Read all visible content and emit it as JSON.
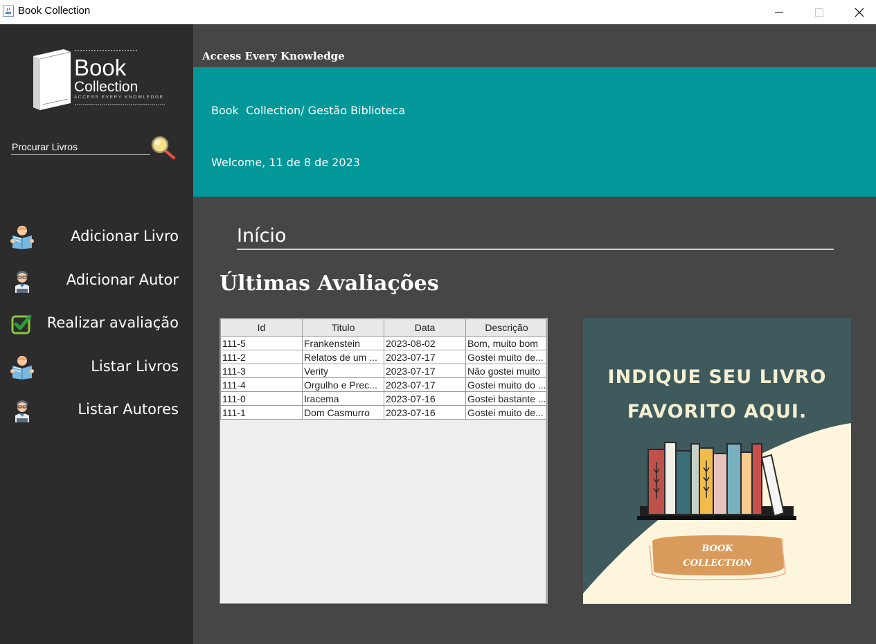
{
  "window": {
    "title": "Book Collection"
  },
  "sidebar": {
    "logo": {
      "word1": "Book",
      "word2": "Collection",
      "tagline": "ACCESS EVERY KNOWLEDGE"
    },
    "search": {
      "placeholder": "Procurar Livros"
    },
    "items": [
      {
        "label": "Adicionar Livro",
        "icon": "reader-icon"
      },
      {
        "label": "Adicionar Autor",
        "icon": "author-icon"
      },
      {
        "label": "Realizar avaliação",
        "icon": "checkbox-icon"
      },
      {
        "label": "Listar Livros",
        "icon": "reader-icon"
      },
      {
        "label": "Listar Autores",
        "icon": "author-icon"
      }
    ]
  },
  "header": {
    "tagline": "Access Every Knowledge",
    "path": "Book  Collection/ Gestão Biblioteca",
    "welcome": "Welcome, 11 de 8 de 2023"
  },
  "main": {
    "section_title": "Início",
    "reviews_heading": "Últimas Avaliações",
    "table": {
      "columns": [
        "Id",
        "Titulo",
        "Data",
        "Descrição"
      ],
      "rows": [
        [
          "111-5",
          "Frankenstein",
          "2023-08-02",
          "Bom, muito bom"
        ],
        [
          "111-2",
          "Relatos de um ...",
          "2023-07-17",
          "Gostei muito de..."
        ],
        [
          "111-3",
          "Verity",
          "2023-07-17",
          "Não gostei muito"
        ],
        [
          "111-4",
          "Orgulho e Prec...",
          "2023-07-17",
          "Gostei muito do ..."
        ],
        [
          "111-0",
          "Iracema",
          "2023-07-16",
          "Gostei bastante ..."
        ],
        [
          "111-1",
          "Dom Casmurro",
          "2023-07-16",
          "Gostei muito de..."
        ]
      ]
    },
    "promo": {
      "line1": "INDIQUE SEU LIVRO",
      "line2": "FAVORITO AQUI.",
      "button_line1": "BOOK",
      "button_line2": "COLLECTION"
    }
  },
  "colors": {
    "sidebar_bg": "#2c2c2c",
    "main_bg": "#464646",
    "banner_teal": "#02989a",
    "promo_dark": "#3e5a5c",
    "promo_cream": "#fdf6dc",
    "promo_button": "#d99b5c"
  }
}
